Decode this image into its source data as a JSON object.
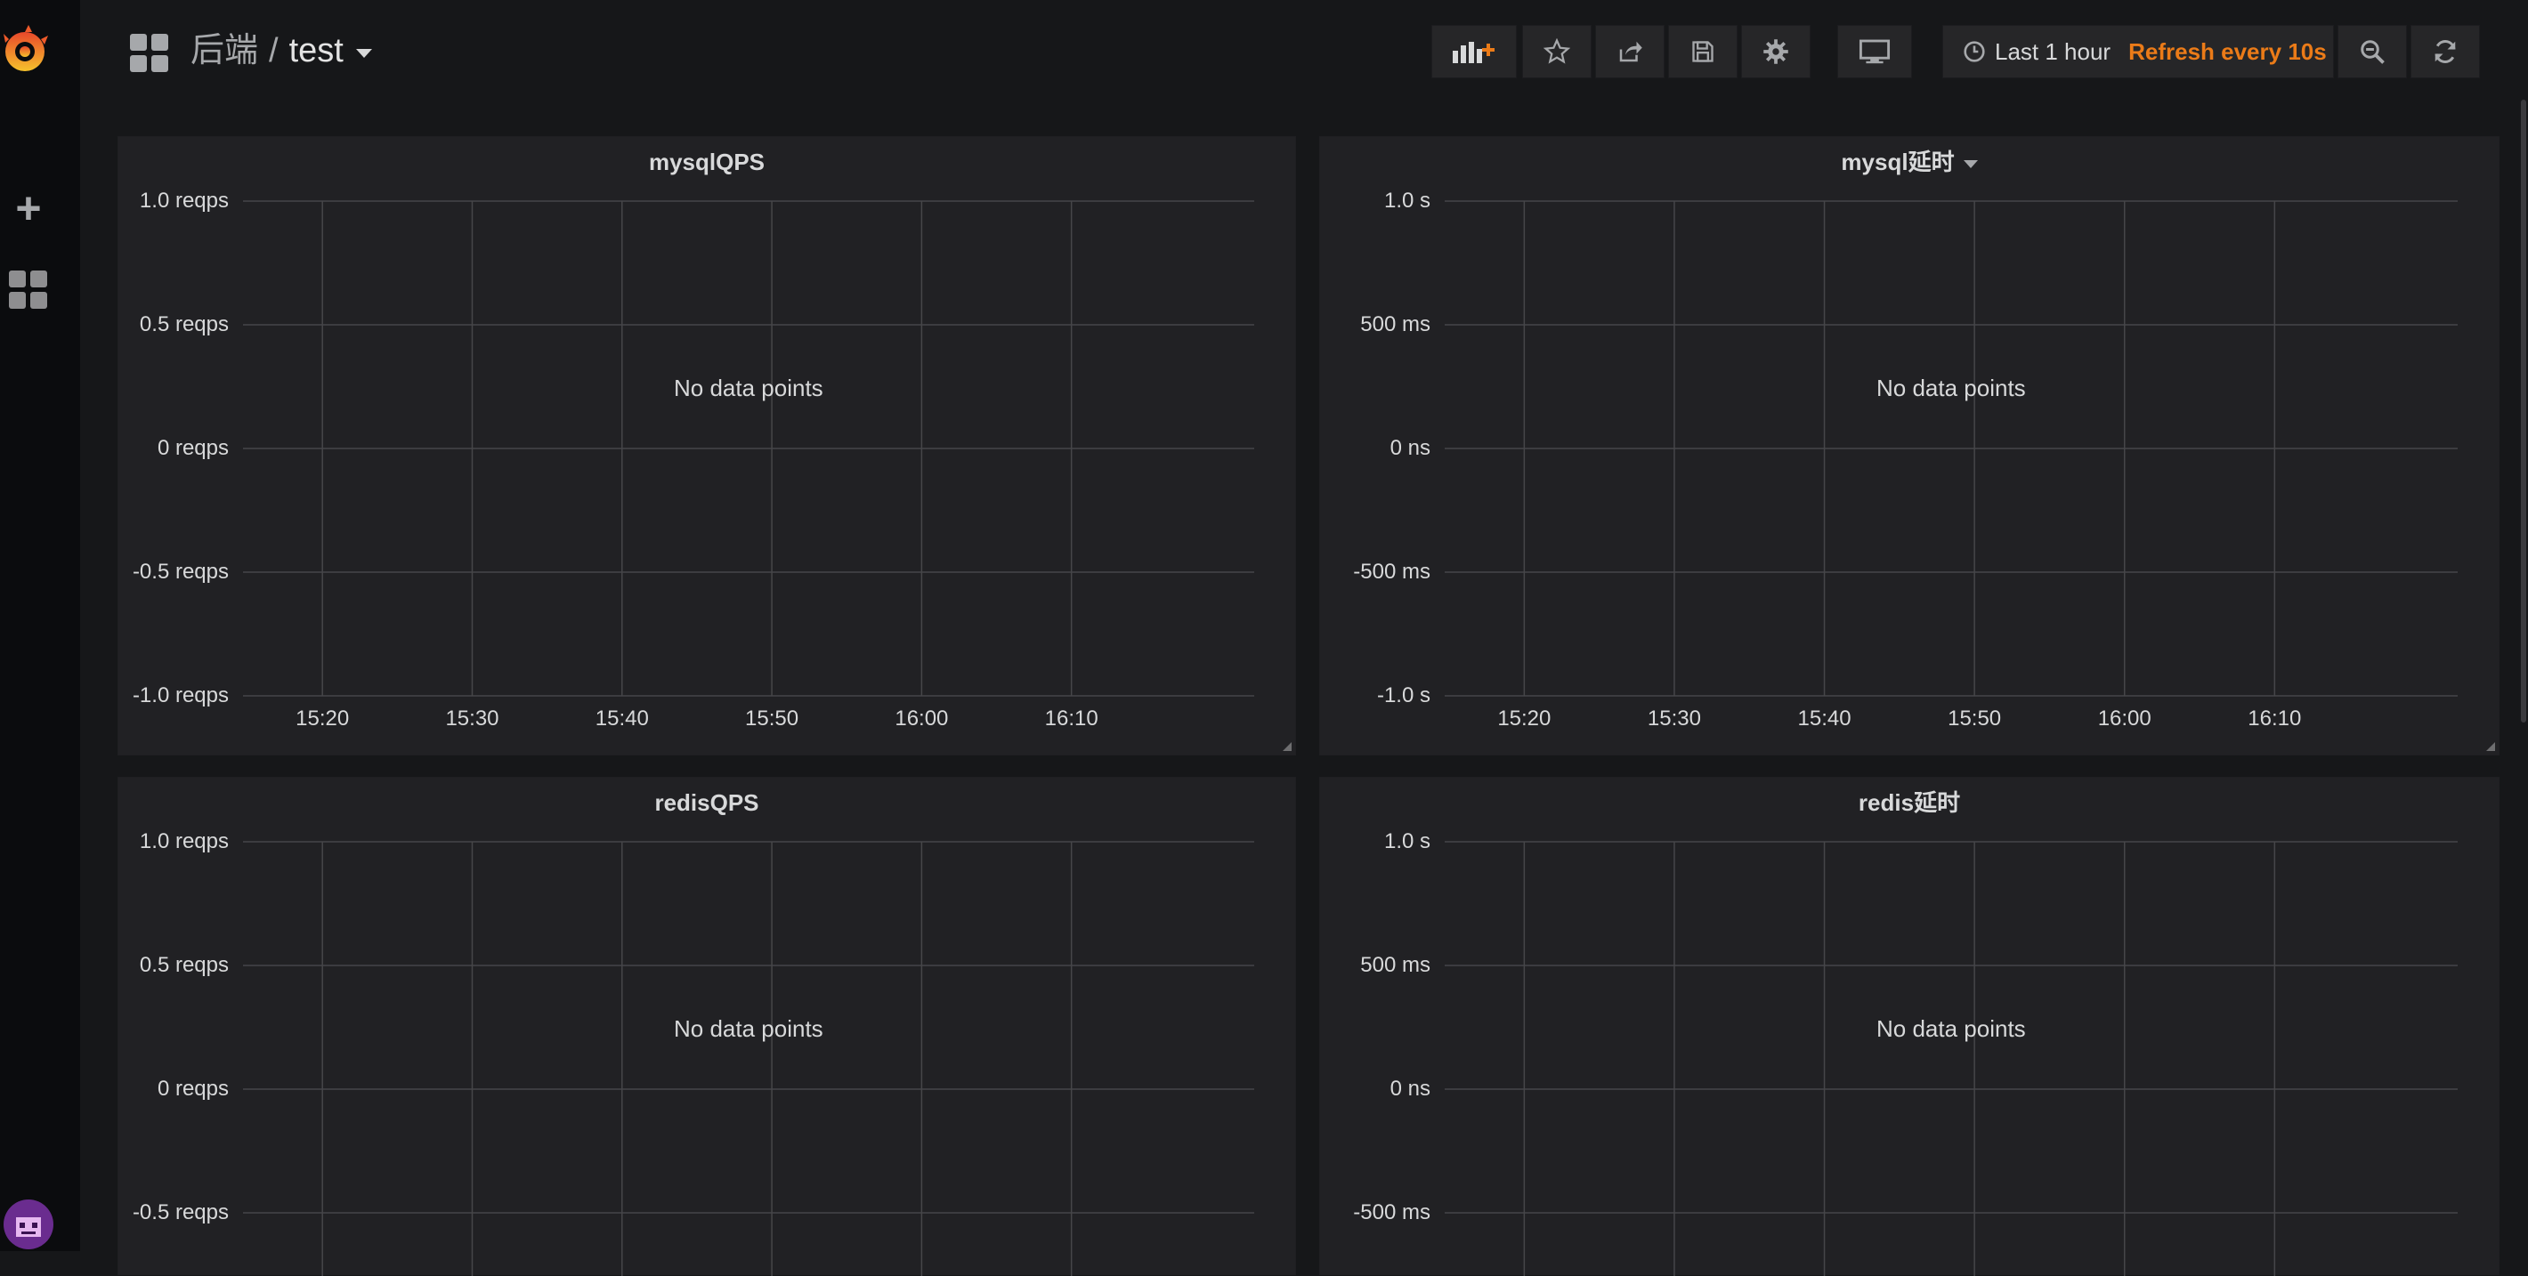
{
  "navbar": {
    "folder": "后端",
    "separator": "/",
    "dashboard_title": "test",
    "time_range": "Last 1 hour",
    "refresh": "Refresh every 10s"
  },
  "icons": {
    "logo": "grafana-logo-icon",
    "create": "plus-icon",
    "dashboards": "grid-icon",
    "add_panel": "add-panel-icon",
    "star": "star-icon",
    "share": "share-icon",
    "save": "save-icon",
    "settings": "gear-icon",
    "tv": "monitor-icon",
    "clock": "clock-icon",
    "zoom": "zoom-out-icon",
    "refresh": "refresh-icon"
  },
  "colors": {
    "background": "#161719",
    "panel": "#212124",
    "accent": "#eb7b18"
  },
  "panels": [
    {
      "title": "mysqlQPS",
      "has_menu": false,
      "no_data": "No data points",
      "y_ticks": [
        "1.0 reqps",
        "0.5 reqps",
        "0 reqps",
        "-0.5 reqps",
        "-1.0 reqps"
      ],
      "x_ticks": [
        "15:20",
        "15:30",
        "15:40",
        "15:50",
        "16:00",
        "16:10"
      ]
    },
    {
      "title": "mysql延时",
      "has_menu": true,
      "no_data": "No data points",
      "y_ticks": [
        "1.0 s",
        "500 ms",
        "0 ns",
        "-500 ms",
        "-1.0 s"
      ],
      "x_ticks": [
        "15:20",
        "15:30",
        "15:40",
        "15:50",
        "16:00",
        "16:10"
      ]
    },
    {
      "title": "redisQPS",
      "has_menu": false,
      "no_data": "No data points",
      "y_ticks": [
        "1.0 reqps",
        "0.5 reqps",
        "0 reqps",
        "-0.5 reqps"
      ],
      "x_ticks": []
    },
    {
      "title": "redis延时",
      "has_menu": false,
      "no_data": "No data points",
      "y_ticks": [
        "1.0 s",
        "500 ms",
        "0 ns",
        "-500 ms"
      ],
      "x_ticks": []
    }
  ]
}
